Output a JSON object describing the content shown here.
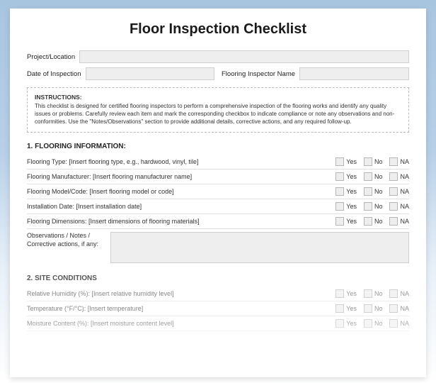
{
  "title": "Floor Inspection Checklist",
  "fields": {
    "projectLocation": {
      "label": "Project/Location",
      "value": ""
    },
    "dateOfInspection": {
      "label": "Date of Inspection",
      "value": ""
    },
    "inspectorName": {
      "label": "Flooring Inspector Name",
      "value": ""
    }
  },
  "instructions": {
    "heading": "INSTRUCTIONS:",
    "body": "This checklist is designed for certified flooring inspectors to perform a comprehensive inspection of the flooring works and identify any quality issues or problems. Carefully review each item and mark the corresponding checkbox to indicate compliance or note any observations and non-conformities. Use the \"Notes/Observations\" section to provide additional details, corrective actions, and any required follow-up."
  },
  "checkOptions": {
    "yes": "Yes",
    "no": "No",
    "na": "NA"
  },
  "section1": {
    "heading": "1. FLOORING INFORMATION:",
    "items": [
      "Flooring Type: [Insert flooring type, e.g., hardwood, vinyl, tile]",
      "Flooring Manufacturer: [Insert flooring manufacturer name]",
      "Flooring Model/Code: [Insert flooring model or code]",
      "Installation Date: [Insert installation date]",
      "Flooring Dimensions: [Insert dimensions of flooring materials]"
    ],
    "notesLabel": "Observations / Notes / Corrective actions, if any:"
  },
  "section2": {
    "heading": "2. SITE CONDITIONS",
    "items": [
      "Relative Humidity (%): [Insert relative humidity level]",
      "Temperature (°F/°C): [Insert temperature]",
      "Moisture Content (%): [Insert moisture content level]"
    ]
  }
}
